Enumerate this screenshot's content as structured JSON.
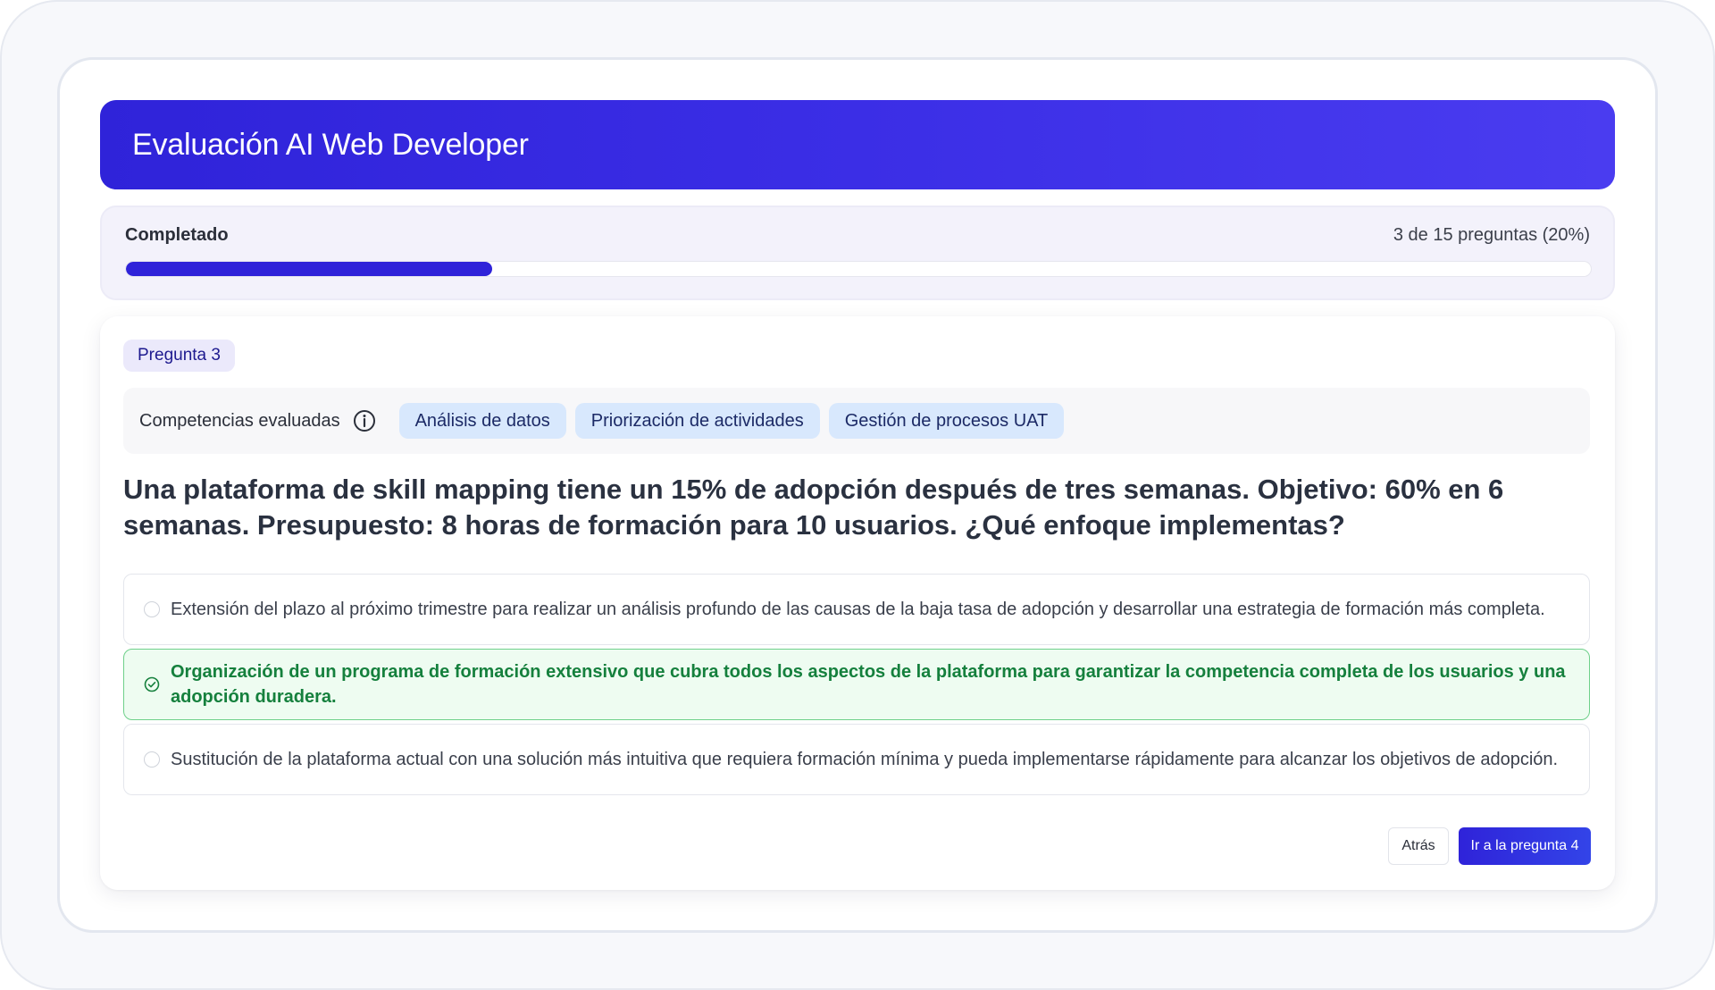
{
  "header": {
    "title": "Evaluación AI Web Developer"
  },
  "progress": {
    "label": "Completado",
    "count_text": "3 de 15 preguntas (20%)",
    "fraction": 0.25
  },
  "question": {
    "badge": "Pregunta 3",
    "competencies_label": "Competencias evaluadas",
    "competencies": [
      "Análisis de datos",
      "Priorización de actividades",
      "Gestión de procesos UAT"
    ],
    "text": "Una plataforma de skill mapping tiene un 15% de adopción después de tres semanas. Objetivo: 60% en 6 semanas. Presupuesto: 8 horas de formación para 10 usuarios. ¿Qué enfoque implementas?",
    "options": [
      {
        "text": "Extensión del plazo al próximo trimestre para realizar un análisis profundo de las causas de la baja tasa de adopción y desarrollar una estrategia de formación más completa.",
        "selected": false
      },
      {
        "text": "Organización de un programa de formación extensivo que cubra todos los aspectos de la plataforma para garantizar la competencia completa de los usuarios y una adopción duradera.",
        "selected": true
      },
      {
        "text": "Sustitución de la plataforma actual con una solución más intuitiva que requiera formación mínima y pueda implementarse rápidamente para alcanzar los objetivos de adopción.",
        "selected": false
      }
    ]
  },
  "actions": {
    "back_label": "Atrás",
    "next_label": "Ir a la pregunta 4"
  },
  "colors": {
    "accent": "#2f23d9",
    "selected_border": "#6ed08a",
    "selected_text": "#15803d",
    "chip_bg": "#d8e8fd"
  },
  "icons": {
    "info": "info-circle-icon",
    "selected": "check-circle-icon"
  }
}
